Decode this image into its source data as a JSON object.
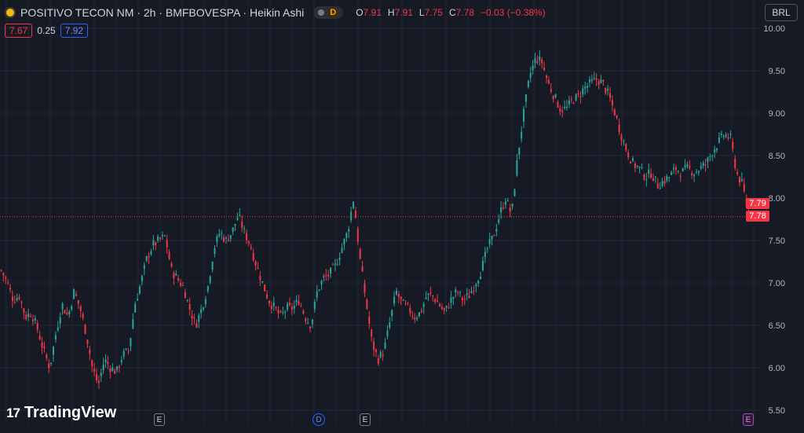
{
  "header": {
    "title": "POSITIVO TECON NM · 2h · BMFBOVESPA · Heikin Ashi",
    "badge": "D",
    "ohlc": [
      {
        "k": "O",
        "v": "7.91"
      },
      {
        "k": "H",
        "v": "7.91"
      },
      {
        "k": "L",
        "v": "7.75"
      },
      {
        "k": "C",
        "v": "7.78"
      },
      {
        "k": "",
        "v": "−0.03 (−0.38%)"
      }
    ]
  },
  "quote": {
    "bid": "7.67",
    "spread": "0.25",
    "ask": "7.92"
  },
  "currency": "BRL",
  "brand": "TradingView",
  "price_tags": {
    "high": "7.79",
    "last": "7.78"
  },
  "events": [
    {
      "label": "E",
      "kind": "e"
    },
    {
      "label": "D",
      "kind": "d"
    },
    {
      "label": "E",
      "kind": "e"
    },
    {
      "label": "E",
      "kind": "p"
    }
  ],
  "colors": {
    "up": "#26a69a",
    "down": "#f23645",
    "bg": "#161a25",
    "grid": "#232733"
  },
  "chart_data": {
    "type": "candlestick",
    "style": "Heikin Ashi",
    "y_ticks": [
      "10.00",
      "9.50",
      "9.00",
      "8.50",
      "8.00",
      "7.50",
      "7.00",
      "6.50",
      "6.00",
      "5.50"
    ],
    "ylim": [
      5.5,
      10.0
    ],
    "last_price": 7.78,
    "grid": true,
    "path_close": [
      7.15,
      7.0,
      6.8,
      6.85,
      6.6,
      6.65,
      6.45,
      6.2,
      6.0,
      6.4,
      6.75,
      6.6,
      6.9,
      6.7,
      6.4,
      6.0,
      5.8,
      6.1,
      6.0,
      5.95,
      6.15,
      6.2,
      6.75,
      7.0,
      7.3,
      7.45,
      7.5,
      7.55,
      7.15,
      7.05,
      6.95,
      6.7,
      6.5,
      6.7,
      6.95,
      7.4,
      7.6,
      7.5,
      7.6,
      7.8,
      7.6,
      7.45,
      7.2,
      7.0,
      6.8,
      6.7,
      6.6,
      6.7,
      6.7,
      6.8,
      6.6,
      6.5,
      6.9,
      7.05,
      7.1,
      7.2,
      7.4,
      7.6,
      8.0,
      7.3,
      6.8,
      6.3,
      6.1,
      6.2,
      6.55,
      6.9,
      6.75,
      6.7,
      6.6,
      6.65,
      6.85,
      6.85,
      6.75,
      6.65,
      6.8,
      6.9,
      6.8,
      6.85,
      7.0,
      7.15,
      7.4,
      7.55,
      7.8,
      8.0,
      7.8,
      8.5,
      9.0,
      9.45,
      9.65,
      9.6,
      9.35,
      9.2,
      9.05,
      9.05,
      9.15,
      9.2,
      9.3,
      9.35,
      9.4,
      9.35,
      9.2,
      9.0,
      8.75,
      8.55,
      8.4,
      8.35,
      8.25,
      8.3,
      8.15,
      8.2,
      8.25,
      8.35,
      8.3,
      8.35,
      8.3,
      8.35,
      8.4,
      8.55,
      8.65,
      8.75,
      8.7,
      8.3,
      8.15,
      7.78
    ]
  }
}
